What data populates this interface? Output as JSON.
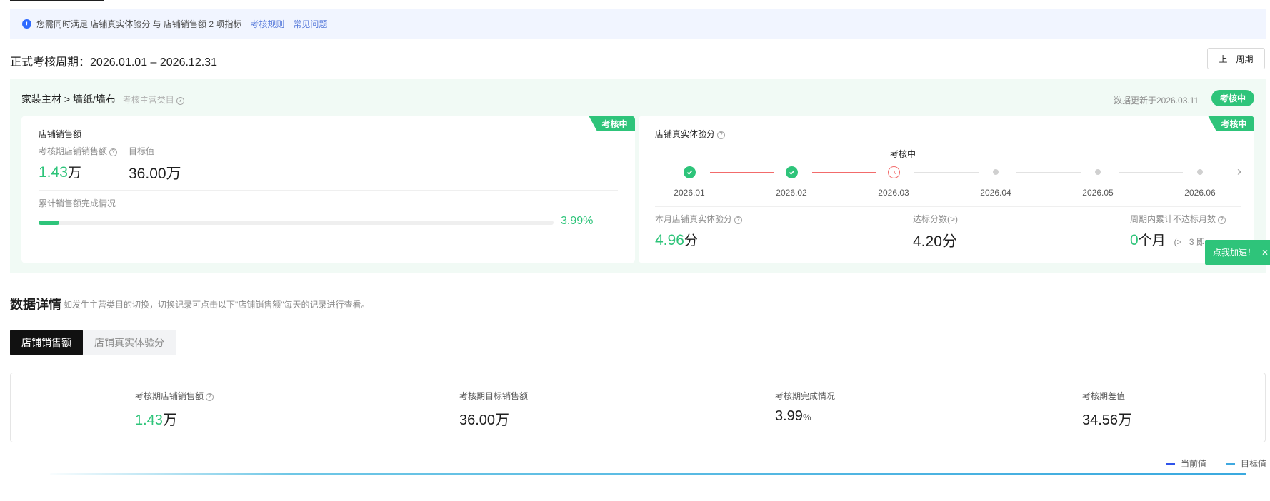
{
  "notice": {
    "text": "您需同时满足 店铺真实体验分 与 店铺销售额 2 项指标",
    "links": [
      "考核规则",
      "常见问题"
    ]
  },
  "period": {
    "label": "正式考核周期：",
    "range": "2026.01.01 – 2026.12.31",
    "prev_button": "上一周期"
  },
  "panel": {
    "breadcrumb": "家装主材 > 墙纸/墙布",
    "breadcrumb_sub": "考核主营类目",
    "update_text": "数据更新于2026.03.11",
    "status_badge": "考核中"
  },
  "sales_card": {
    "tag": "考核中",
    "title": "店铺销售额",
    "metric_label": "考核期店铺销售额",
    "metric_value": "1.43",
    "metric_unit": "万",
    "target_label": "目标值",
    "target_value": "36.00万",
    "progress_label": "累计销售额完成情况",
    "progress_percent": 3.99,
    "progress_text": "3.99%"
  },
  "experience_card": {
    "tag": "考核中",
    "title": "店铺真实体验分",
    "timeline_current_label": "考核中",
    "months": [
      "2026.01",
      "2026.02",
      "2026.03",
      "2026.04",
      "2026.05",
      "2026.06"
    ],
    "month_status": [
      "done",
      "done",
      "current",
      "pending",
      "pending",
      "pending"
    ],
    "score_label": "本月店铺真实体验分",
    "score_value": "4.96",
    "score_unit": "分",
    "threshold_label": "达标分数(>)",
    "threshold_value": "4.20分",
    "fail_label": "周期内累计不达标月数",
    "fail_value": "0",
    "fail_unit": "个月",
    "fail_hint": "(>= 3 即"
  },
  "float_button": {
    "label": "点我加速！",
    "close": "✕"
  },
  "details": {
    "title": "数据详情",
    "subtitle": "如发生主营类目的切换，切换记录可点击以下\"店铺销售额\"每天的记录进行查看。",
    "tabs": [
      "店铺销售额",
      "店铺真实体验分"
    ],
    "stats": [
      {
        "label": "考核期店铺销售额",
        "value": "1.43",
        "unit": "万"
      },
      {
        "label": "考核期目标销售额",
        "value": "36.00万"
      },
      {
        "label": "考核期完成情况",
        "value": "3.99",
        "unit": "%"
      },
      {
        "label": "考核期差值",
        "value": "34.56万"
      }
    ]
  },
  "legend": {
    "current": "当前值",
    "target": "目标值",
    "current_color": "#2f54eb",
    "target_color": "#40a9e0"
  },
  "colors": {
    "accent_green": "#2ec47a",
    "info_blue": "#2f6bff",
    "alert_red": "#f26b6b"
  }
}
